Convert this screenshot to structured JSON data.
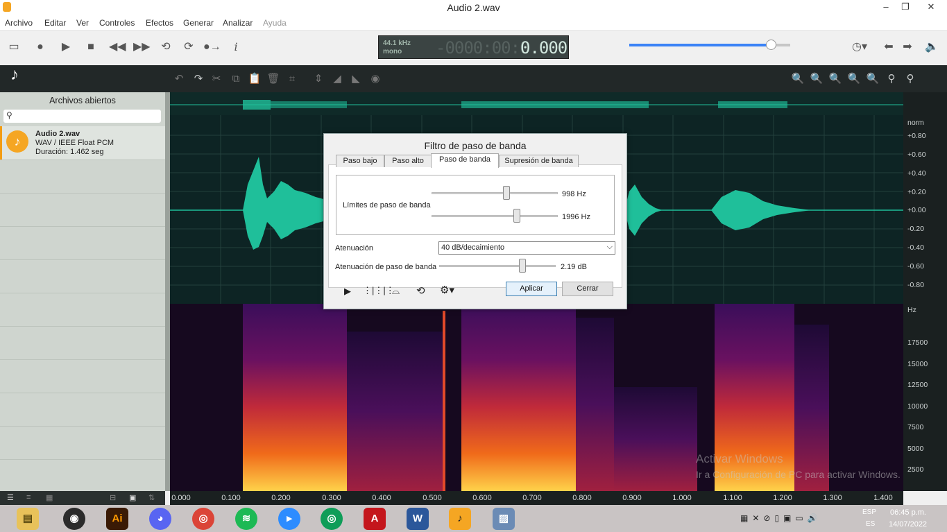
{
  "window": {
    "title": "Audio 2.wav"
  },
  "menu": [
    "Archivo",
    "Editar",
    "Ver",
    "Controles",
    "Efectos",
    "Generar",
    "Analizar",
    "Ayuda"
  ],
  "lcd": {
    "rate": "44.1 kHz",
    "channels": "mono",
    "dim_time": "-0000:00:0",
    "time": "0.000"
  },
  "playback": {
    "position": 0.88
  },
  "sidebar": {
    "header": "Archivos abiertos",
    "search_placeholder": "",
    "file": {
      "name": "Audio 2.wav",
      "format": "WAV / IEEE Float PCM",
      "duration": "Duración: 1.462 seg"
    }
  },
  "amp_scale": {
    "unit": "norm",
    "ticks": [
      "+0.80",
      "+0.60",
      "+0.40",
      "+0.20",
      "+0.00",
      "-0.20",
      "-0.40",
      "-0.60",
      "-0.80"
    ]
  },
  "freq_scale": {
    "unit": "Hz",
    "ticks": [
      "17500",
      "15000",
      "12500",
      "10000",
      "7500",
      "5000",
      "2500"
    ]
  },
  "timeline": [
    "0.000",
    "0.100",
    "0.200",
    "0.300",
    "0.400",
    "0.500",
    "0.600",
    "0.700",
    "0.800",
    "0.900",
    "1.000",
    "1.100",
    "1.200",
    "1.300",
    "1.400"
  ],
  "dialog": {
    "title": "Filtro de paso de banda",
    "tabs": [
      "Paso bajo",
      "Paso alto",
      "Paso de banda",
      "Supresión de banda"
    ],
    "limits_label": "Límites de paso de banda",
    "low_value": "998 Hz",
    "high_value": "1996 Hz",
    "attenuation_label": "Atenuación",
    "attenuation_value": "40 dB/decaimiento",
    "pass_att_label": "Atenuación de paso de banda",
    "pass_att_value": "2.19 dB",
    "apply": "Aplicar",
    "close": "Cerrar"
  },
  "watermark": {
    "line1": "Activar Windows",
    "line2": "Ir a Configuración de PC para activar Windows."
  },
  "tray": {
    "lang1": "ESP",
    "lang2": "ES",
    "time": "06:45 p.m.",
    "date": "14/07/2022"
  },
  "colors": {
    "accent": "#3b82f6",
    "wave": "#1fbf9a",
    "dark": "#0d1414"
  }
}
